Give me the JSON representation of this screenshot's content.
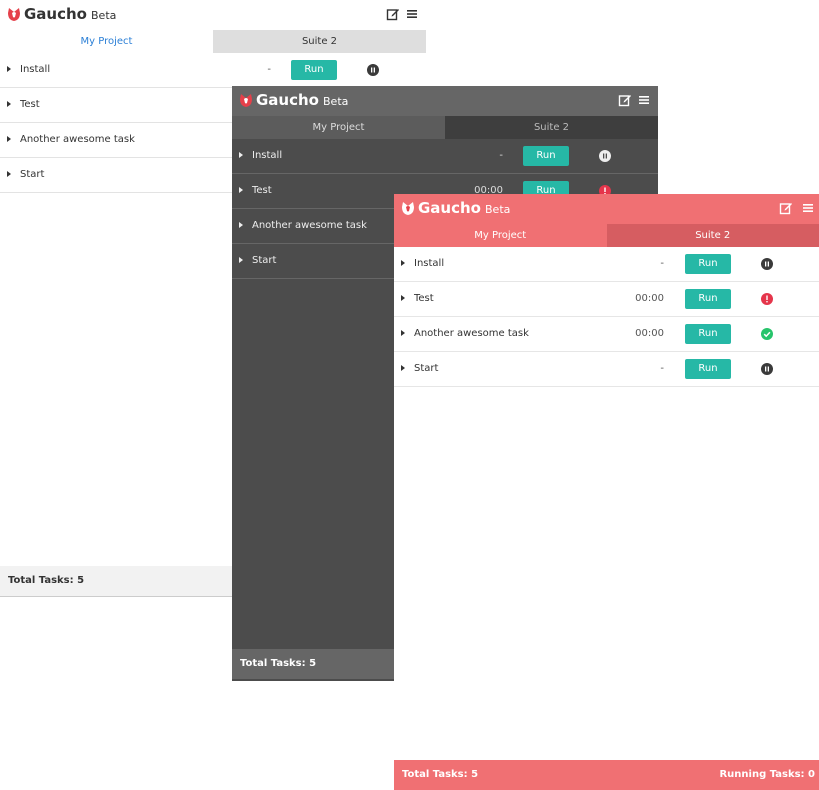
{
  "app": {
    "name": "Gaucho",
    "badge": "Beta",
    "tabs": [
      "My Project",
      "Suite 2"
    ]
  },
  "colors": {
    "run_button": "#26b8a6",
    "dark_theme": "#4c4c4c",
    "coral_theme": "#f07073",
    "active_tab_link": "#2b7fd6",
    "status_paused": "#3a3a3a",
    "status_error": "#e5354b",
    "status_success": "#27c46b"
  },
  "windows": [
    {
      "theme": "light",
      "tasks": [
        {
          "name": "Install",
          "time": "-",
          "run_label": "Run",
          "status": "paused-icon"
        },
        {
          "name": "Test",
          "time": "",
          "run_label": "",
          "status": ""
        },
        {
          "name": "Another awesome task",
          "time": "",
          "run_label": "",
          "status": ""
        },
        {
          "name": "Start",
          "time": "",
          "run_label": "",
          "status": ""
        }
      ],
      "footer": {
        "total": "Total Tasks: 5",
        "running": ""
      }
    },
    {
      "theme": "dark",
      "tasks": [
        {
          "name": "Install",
          "time": "-",
          "run_label": "Run",
          "status": "paused-icon"
        },
        {
          "name": "Test",
          "time": "00:00",
          "run_label": "Run",
          "status": "error-icon"
        },
        {
          "name": "Another awesome task",
          "time": "",
          "run_label": "",
          "status": ""
        },
        {
          "name": "Start",
          "time": "",
          "run_label": "",
          "status": ""
        }
      ],
      "footer": {
        "total": "Total Tasks: 5",
        "running": ""
      }
    },
    {
      "theme": "coral",
      "tasks": [
        {
          "name": "Install",
          "time": "-",
          "run_label": "Run",
          "status": "paused-icon"
        },
        {
          "name": "Test",
          "time": "00:00",
          "run_label": "Run",
          "status": "error-icon"
        },
        {
          "name": "Another awesome task",
          "time": "00:00",
          "run_label": "Run",
          "status": "success-icon"
        },
        {
          "name": "Start",
          "time": "-",
          "run_label": "Run",
          "status": "paused-icon"
        }
      ],
      "footer": {
        "total": "Total Tasks: 5",
        "running": "Running Tasks: 0"
      }
    }
  ]
}
